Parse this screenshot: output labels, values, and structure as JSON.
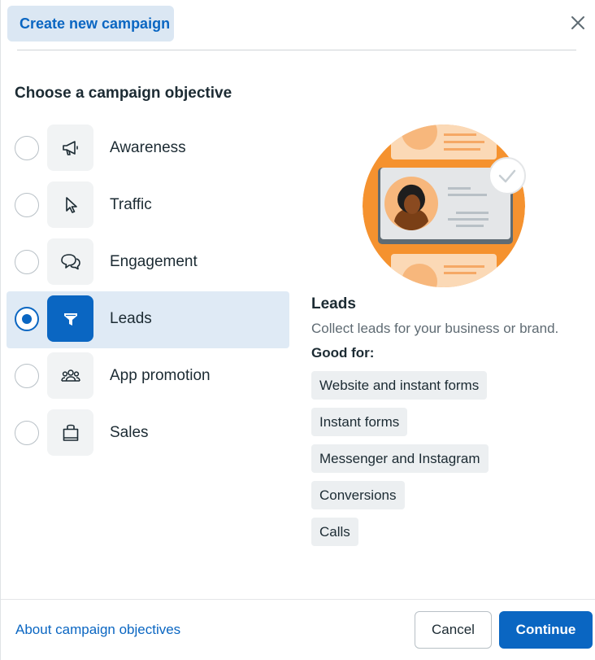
{
  "header": {
    "title": "Create new campaign",
    "close_icon": "close-icon"
  },
  "section_title": "Choose a campaign objective",
  "objectives": [
    {
      "label": "Awareness",
      "icon": "megaphone-icon",
      "selected": false
    },
    {
      "label": "Traffic",
      "icon": "cursor-icon",
      "selected": false
    },
    {
      "label": "Engagement",
      "icon": "chat-bubbles-icon",
      "selected": false
    },
    {
      "label": "Leads",
      "icon": "funnel-icon",
      "selected": true
    },
    {
      "label": "App promotion",
      "icon": "people-group-icon",
      "selected": false
    },
    {
      "label": "Sales",
      "icon": "shopping-bag-icon",
      "selected": false
    }
  ],
  "detail": {
    "title": "Leads",
    "description": "Collect leads for your business or brand.",
    "good_for_label": "Good for:",
    "tags": [
      "Website and instant forms",
      "Instant forms",
      "Messenger and Instagram",
      "Conversions",
      "Calls"
    ]
  },
  "footer": {
    "about_link": "About campaign objectives",
    "cancel": "Cancel",
    "continue": "Continue"
  },
  "colors": {
    "accent": "#0a66c2",
    "selected_bg": "#dfeaf5",
    "illustration_orange": "#f5922f"
  }
}
